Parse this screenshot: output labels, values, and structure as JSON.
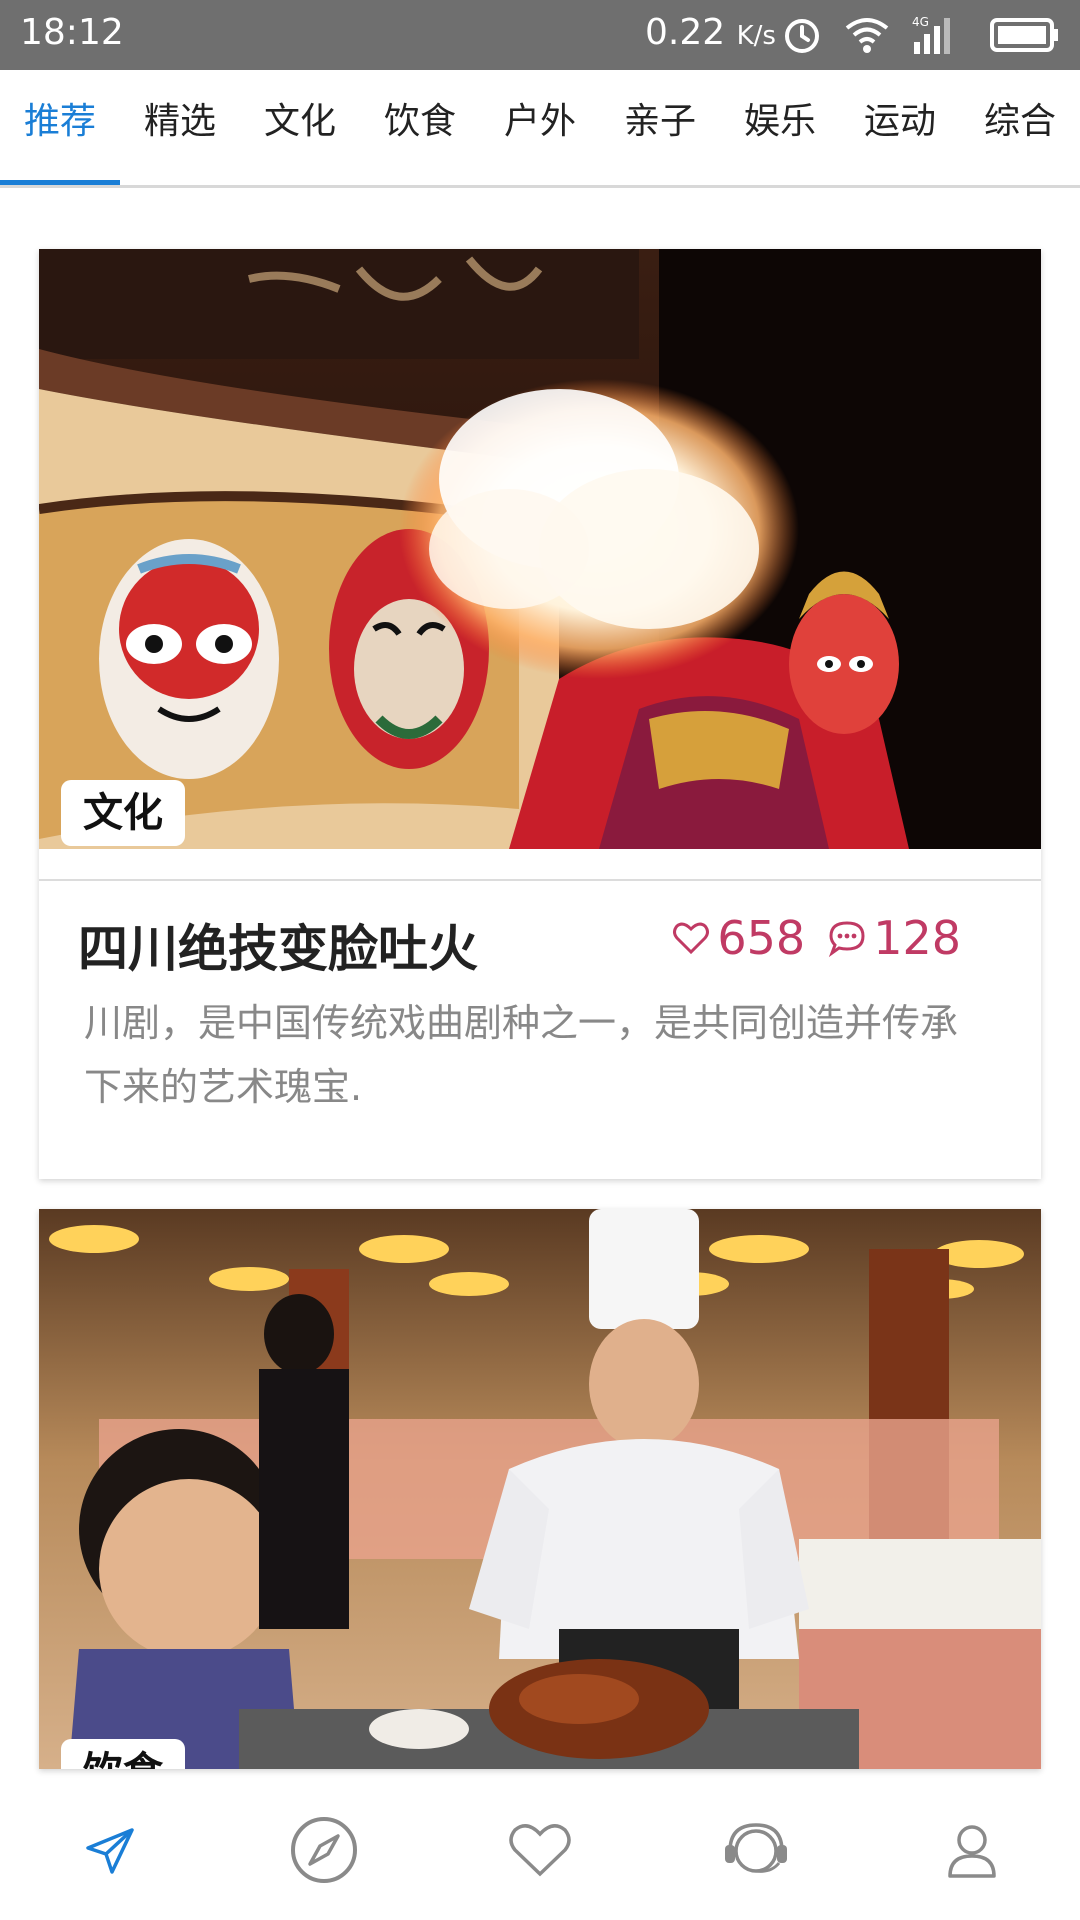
{
  "status_bar": {
    "time": "18:12",
    "speed_value": "0.22",
    "speed_unit": "K/s",
    "icons": [
      "alarm-icon",
      "wifi-icon",
      "signal-4g-icon",
      "battery-icon"
    ]
  },
  "tabs": [
    {
      "label": "推荐",
      "active": true
    },
    {
      "label": "精选",
      "active": false
    },
    {
      "label": "文化",
      "active": false
    },
    {
      "label": "饮食",
      "active": false
    },
    {
      "label": "户外",
      "active": false
    },
    {
      "label": "亲子",
      "active": false
    },
    {
      "label": "娱乐",
      "active": false
    },
    {
      "label": "运动",
      "active": false
    },
    {
      "label": "综合",
      "active": false
    }
  ],
  "cards": [
    {
      "tag": "文化",
      "title": "四川绝技变脸吐火",
      "likes": "658",
      "comments": "128",
      "description": "川剧，是中国传统戏曲剧种之一，是共同创造并传承下来的艺术瑰宝."
    },
    {
      "tag": "饮食"
    }
  ],
  "bottom_nav": [
    "send-icon",
    "compass-icon",
    "heart-icon",
    "headset-icon",
    "user-icon"
  ],
  "colors": {
    "accent": "#1a7ed6",
    "stats": "#c03a64",
    "status_bar": "#6f6f6f"
  }
}
